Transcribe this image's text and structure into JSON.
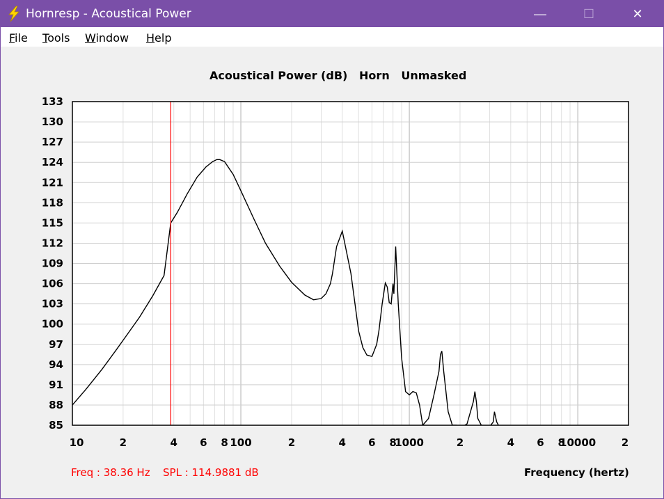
{
  "window": {
    "title": "Hornresp - Acoustical Power",
    "minimize_glyph": "—",
    "maximize_glyph": "☐",
    "close_glyph": "✕",
    "icon": "lightning-bolt-icon"
  },
  "menu": {
    "items": [
      {
        "underline": "F",
        "rest": "ile"
      },
      {
        "underline": "T",
        "rest": "ools"
      },
      {
        "underline": "W",
        "rest": "indow"
      },
      {
        "underline": "H",
        "rest": "elp"
      }
    ]
  },
  "chart_data": {
    "type": "line",
    "title": "Acoustical Power (dB)   Horn   Unmasked",
    "xlabel": "Frequency (hertz)",
    "ylabel": "",
    "x_scale": "log",
    "xlim": [
      10,
      20000
    ],
    "ylim": [
      85,
      133
    ],
    "y_ticks": [
      "133",
      "130",
      "127",
      "124",
      "121",
      "118",
      "115",
      "112",
      "109",
      "106",
      "103",
      "100",
      "97",
      "94",
      "91",
      "88",
      "85"
    ],
    "x_tick_labels": [
      "10",
      "2",
      "4",
      "6",
      "8",
      "100",
      "2",
      "4",
      "6",
      "8",
      "1000",
      "2",
      "4",
      "6",
      "8",
      "10000",
      "2"
    ],
    "grid": true,
    "colors": {
      "curve": "#000000",
      "cursor": "#ff0000",
      "grid": "#c8c8c8"
    },
    "series": [
      {
        "x": [
          10,
          12,
          15,
          18,
          20,
          25,
          30,
          35,
          38.36,
          42,
          48,
          55,
          62,
          68,
          72,
          75,
          80,
          90,
          100,
          120,
          140,
          170,
          200,
          240,
          270,
          300,
          320,
          340,
          350,
          370,
          400,
          450,
          500,
          530,
          560,
          600,
          640,
          660,
          690,
          720,
          740,
          760,
          780,
          790,
          800,
          810,
          830,
          860,
          900,
          950,
          1000,
          1050,
          1100,
          1150,
          1200,
          1300,
          1400,
          1500,
          1530,
          1560,
          1600,
          1700,
          1800,
          1900,
          2000,
          2100,
          2200,
          2400,
          2450,
          2500,
          2550,
          2700,
          3000,
          3150,
          3200,
          3300,
          3400
        ],
        "y": [
          88.0,
          90.3,
          93.3,
          96.0,
          97.6,
          101.0,
          104.2,
          107.2,
          115.0,
          116.6,
          119.3,
          121.8,
          123.3,
          124.1,
          124.4,
          124.4,
          124.1,
          122.2,
          119.8,
          115.5,
          112.0,
          108.6,
          106.2,
          104.3,
          103.6,
          103.8,
          104.5,
          106.0,
          107.5,
          111.5,
          113.8,
          107.5,
          99.0,
          96.5,
          95.4,
          95.2,
          97.0,
          99.0,
          103.0,
          106.1,
          105.5,
          103.2,
          103.0,
          104.5,
          106.0,
          104.5,
          111.5,
          103.0,
          95.0,
          90.0,
          89.5,
          90.0,
          89.8,
          88.0,
          85.0,
          86.0,
          89.5,
          93.0,
          95.5,
          96.0,
          93.0,
          87.0,
          85.0,
          85.0,
          84.8,
          84.9,
          85.2,
          88.5,
          90.0,
          88.5,
          86.0,
          84.8,
          84.8,
          85.5,
          87.0,
          85.5,
          84.9
        ]
      }
    ],
    "cursor": {
      "freq": 38.36,
      "spl": 114.9881
    }
  },
  "readout": {
    "freq": "Freq : 38.36 Hz",
    "spl": "SPL : 114.9881 dB"
  }
}
